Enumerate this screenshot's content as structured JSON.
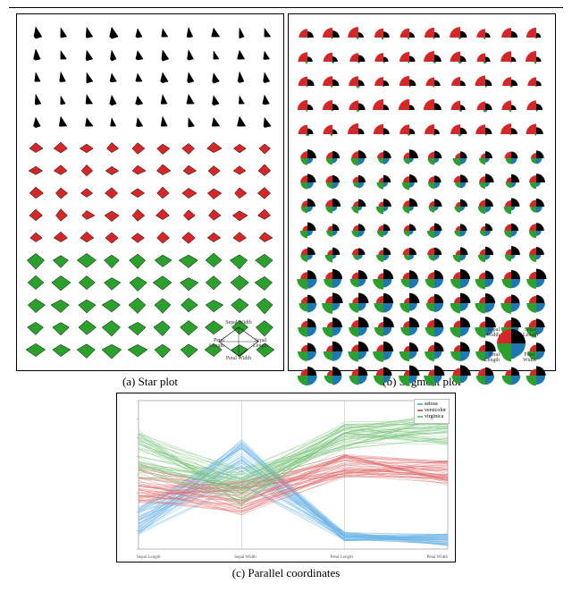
{
  "chart_data": [
    {
      "type": "star-glyph-matrix",
      "title": "Star plot",
      "axes": [
        "Sepal Width",
        "Sepal Length",
        "Petal Width",
        "Petal Length"
      ],
      "groups": [
        {
          "name": "setosa",
          "color": "#000000",
          "rows": 5,
          "cols": 10,
          "shape": {
            "sepal_len": 0.55,
            "sepal_wid": 0.9,
            "petal_len": 0.12,
            "petal_wid": 0.08
          }
        },
        {
          "name": "versicolor",
          "color": "#d62728",
          "rows": 5,
          "cols": 10,
          "shape": {
            "sepal_len": 0.72,
            "sepal_wid": 0.55,
            "petal_len": 0.6,
            "petal_wid": 0.48
          }
        },
        {
          "name": "virginica",
          "color": "#2ca02c",
          "rows": 5,
          "cols": 10,
          "shape": {
            "sepal_len": 0.88,
            "sepal_wid": 0.6,
            "petal_len": 0.88,
            "petal_wid": 0.8
          }
        }
      ],
      "legend": {
        "top": "Sepal Width",
        "right": "Sepal Length",
        "bottom": "Petal Width",
        "left": "Petal Length"
      }
    },
    {
      "type": "segment-glyph-matrix",
      "title": "Segment plot",
      "sectors": [
        {
          "name": "Sepal Width",
          "color": "#d62728"
        },
        {
          "name": "Sepal Length",
          "color": "#000000"
        },
        {
          "name": "Petal Width",
          "color": "#1f77b4"
        },
        {
          "name": "Petal Length",
          "color": "#2ca02c"
        }
      ],
      "groups": [
        {
          "name": "setosa",
          "rows": 5,
          "cols": 10,
          "radii": {
            "sepal_wid": 0.9,
            "sepal_len": 0.55,
            "petal_wid": 0.08,
            "petal_len": 0.12
          }
        },
        {
          "name": "versicolor",
          "rows": 5,
          "cols": 10,
          "radii": {
            "sepal_wid": 0.55,
            "sepal_len": 0.72,
            "petal_wid": 0.48,
            "petal_len": 0.6
          }
        },
        {
          "name": "virginica",
          "rows": 5,
          "cols": 10,
          "radii": {
            "sepal_wid": 0.6,
            "sepal_len": 0.88,
            "petal_wid": 0.8,
            "petal_len": 0.88
          }
        }
      ],
      "legend": {
        "tl": "Sepal Width",
        "tr": "Sepal Length",
        "bl": "Petal Length",
        "br": "Petal Width"
      }
    },
    {
      "type": "parallel-coordinates",
      "title": "Parallel coordinates",
      "axes": [
        "Sepal Length",
        "Sepal Width",
        "Petal Length",
        "Petal Width"
      ],
      "axis_ranges": {
        "Sepal Length": [
          4.3,
          7.9
        ],
        "Sepal Width": [
          2.0,
          4.4
        ],
        "Petal Length": [
          1.0,
          6.9
        ],
        "Petal Width": [
          0.1,
          2.5
        ]
      },
      "series": [
        {
          "name": "setosa",
          "color": "#6fb7e8",
          "n": 50,
          "center": [
            5.0,
            3.4,
            1.5,
            0.25
          ],
          "spread": [
            0.35,
            0.38,
            0.17,
            0.1
          ]
        },
        {
          "name": "versicolor",
          "color": "#e06b6b",
          "n": 50,
          "center": [
            5.9,
            2.8,
            4.3,
            1.33
          ],
          "spread": [
            0.5,
            0.3,
            0.47,
            0.2
          ]
        },
        {
          "name": "virginica",
          "color": "#7ac47a",
          "n": 50,
          "center": [
            6.6,
            3.0,
            5.5,
            2.03
          ],
          "spread": [
            0.6,
            0.3,
            0.55,
            0.27
          ]
        }
      ],
      "legend_labels": [
        "setosa",
        "versicolor",
        "virginica"
      ]
    }
  ],
  "captions": {
    "a": "(a) Star plot",
    "b": "(b) Segment plot",
    "c": "(c) Parallel coordinates"
  }
}
